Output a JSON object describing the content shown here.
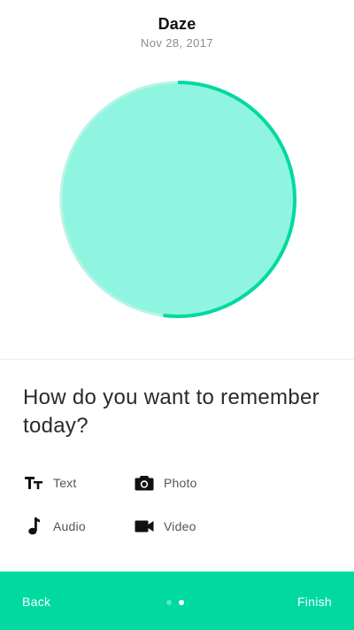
{
  "header": {
    "title": "Daze",
    "date": "Nov 28, 2017"
  },
  "mood": {
    "fill_color": "#8ff5e1",
    "ring_color": "#00d9a0",
    "track_color": "#b8f4e6",
    "progress": 0.52
  },
  "prompt": {
    "question": "How do you want to remember today?"
  },
  "options": [
    {
      "label": "Text",
      "icon": "text-format-icon"
    },
    {
      "label": "Photo",
      "icon": "camera-icon"
    },
    {
      "label": "Audio",
      "icon": "music-note-icon"
    },
    {
      "label": "Video",
      "icon": "video-camera-icon"
    }
  ],
  "footer": {
    "back_label": "Back",
    "finish_label": "Finish",
    "page_count": 2,
    "current_page": 2,
    "background": "#00d9a0"
  }
}
